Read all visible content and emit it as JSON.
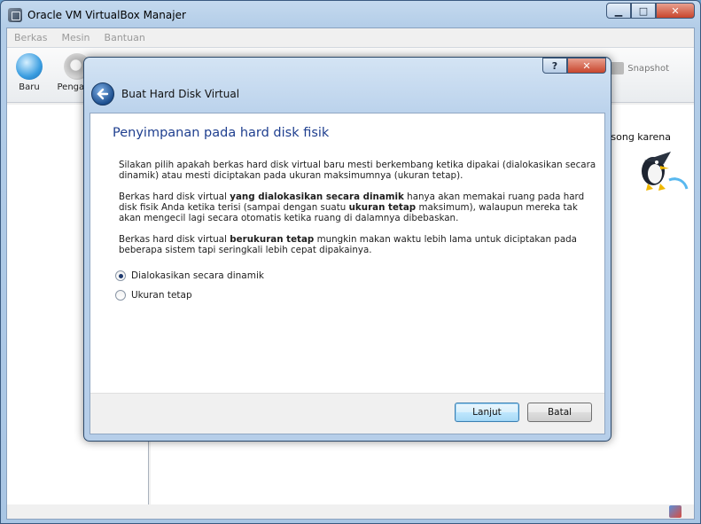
{
  "window": {
    "title": "Oracle VM VirtualBox Manajer",
    "controls": {
      "minimize": "▁",
      "maximize": "□",
      "close": "✕"
    }
  },
  "menu": [
    "Berkas",
    "Mesin",
    "Bantuan"
  ],
  "toolbar": {
    "new_label": "Baru",
    "settings_label": "Pengatur",
    "snapshot_label": "Snapshot"
  },
  "details": {
    "welcome_fragment": "kosong karena"
  },
  "dialog": {
    "title": "Buat Hard Disk Virtual",
    "help": "?",
    "close": "✕",
    "page_title": "Penyimpanan pada hard disk fisik",
    "paragraph1": "Silakan pilih apakah berkas hard disk virtual baru mesti berkembang ketika dipakai (dialokasikan secara dinamik) atau mesti diciptakan pada ukuran maksimumnya (ukuran tetap).",
    "p2_a": "Berkas hard disk virtual ",
    "p2_b": "yang dialokasikan secara dinamik",
    "p2_c": " hanya akan memakai ruang pada hard disk fisik Anda ketika terisi (sampai dengan suatu ",
    "p2_d": "ukuran tetap",
    "p2_e": " maksimum), walaupun mereka tak akan mengecil lagi secara otomatis ketika ruang di dalamnya dibebaskan.",
    "p3_a": "Berkas hard disk virtual ",
    "p3_b": "berukuran tetap",
    "p3_c": " mungkin makan waktu lebih lama untuk diciptakan pada beberapa sistem tapi seringkali lebih cepat dipakainya.",
    "options": [
      {
        "label": "Dialokasikan secara dinamik",
        "checked": true
      },
      {
        "label": "Ukuran tetap",
        "checked": false
      }
    ],
    "next_label": "Lanjut",
    "cancel_label": "Batal"
  }
}
